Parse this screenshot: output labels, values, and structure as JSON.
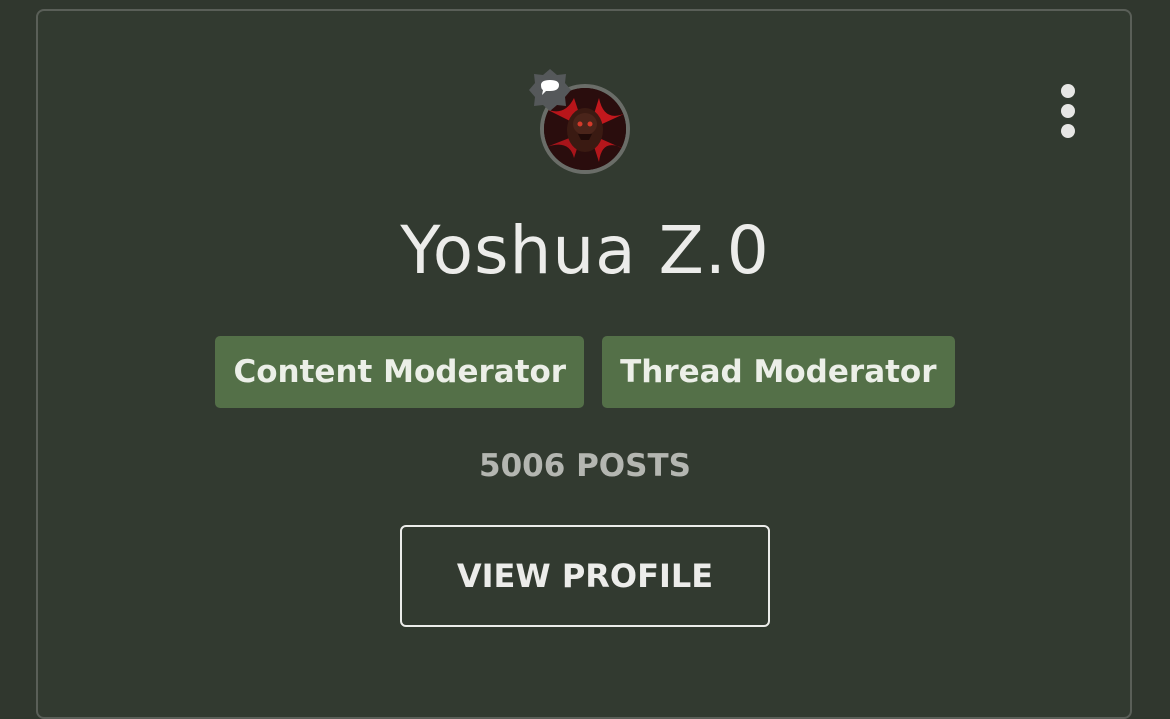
{
  "user": {
    "name": "Yoshua Z.0",
    "posts_label": "5006 POSTS"
  },
  "badges": [
    {
      "label": "Content Moderator"
    },
    {
      "label": "Thread Moderator"
    }
  ],
  "actions": {
    "view_profile_label": "VIEW PROFILE"
  },
  "icons": {
    "menu": "more-vertical-icon",
    "chat": "chat-bubble-icon"
  },
  "colors": {
    "background": "#30372e",
    "card": "#323a30",
    "badge_bg": "#547048",
    "text_primary": "#ececea",
    "text_muted": "#b4b6b1"
  }
}
